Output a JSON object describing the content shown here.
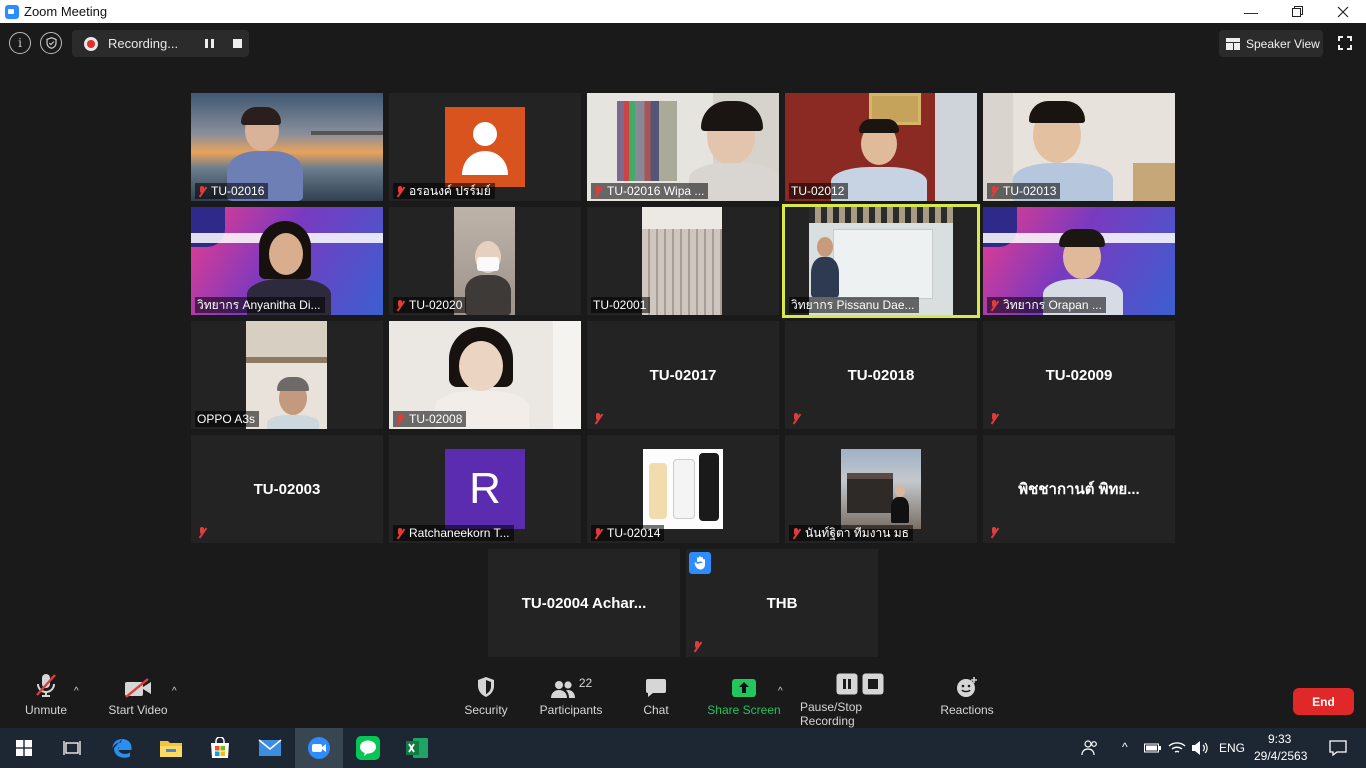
{
  "window": {
    "title": "Zoom Meeting"
  },
  "top_bar": {
    "recording_label": "Recording...",
    "speaker_view_label": "Speaker View"
  },
  "participants": [
    {
      "name": "TU-02016",
      "muted": true,
      "kind": "video"
    },
    {
      "name": "อรอนงค์ ปรร์มย์",
      "muted": true,
      "kind": "avatar"
    },
    {
      "name": "TU-02016 Wipa ...",
      "muted": true,
      "kind": "video"
    },
    {
      "name": "TU-02012",
      "muted": false,
      "kind": "video"
    },
    {
      "name": "TU-02013",
      "muted": true,
      "kind": "video"
    },
    {
      "name": "วิทยากร Anyanitha Di...",
      "muted": false,
      "kind": "video"
    },
    {
      "name": "TU-02020",
      "muted": true,
      "kind": "video"
    },
    {
      "name": "TU-02001",
      "muted": false,
      "kind": "video"
    },
    {
      "name": "วิทยากร Pissanu Dae...",
      "muted": false,
      "kind": "video",
      "active_speaker": true
    },
    {
      "name": "วิทยากร Orapan ...",
      "muted": true,
      "kind": "video"
    },
    {
      "name": "OPPO A3s",
      "muted": false,
      "kind": "video"
    },
    {
      "name": "TU-02008",
      "muted": true,
      "kind": "video"
    },
    {
      "name": "TU-02017",
      "muted": true,
      "kind": "name-only"
    },
    {
      "name": "TU-02018",
      "muted": true,
      "kind": "name-only"
    },
    {
      "name": "TU-02009",
      "muted": true,
      "kind": "name-only"
    },
    {
      "name": "TU-02003",
      "muted": true,
      "kind": "name-only"
    },
    {
      "name": "Ratchaneekorn T...",
      "muted": true,
      "kind": "avatar",
      "initial": "R"
    },
    {
      "name": "TU-02014",
      "muted": true,
      "kind": "video"
    },
    {
      "name": "นันท์ฐิตา ทีมงาน มธ",
      "muted": true,
      "kind": "video"
    },
    {
      "name": "พิชชากานต์ พิทย...",
      "muted": true,
      "kind": "name-only"
    },
    {
      "name": "TU-02004 Achar...",
      "muted": false,
      "kind": "name-only"
    },
    {
      "name": "THB",
      "muted": true,
      "kind": "name-only",
      "hand_raised": true
    }
  ],
  "toolbar": {
    "unmute": "Unmute",
    "start_video": "Start Video",
    "security": "Security",
    "participants": "Participants",
    "participants_count": "22",
    "chat": "Chat",
    "share_screen": "Share Screen",
    "recording": "Pause/Stop Recording",
    "reactions": "Reactions",
    "end": "End"
  },
  "taskbar": {
    "language": "ENG",
    "time": "9:33",
    "date": "29/4/2563"
  },
  "colors": {
    "accent_blue": "#2d8cff",
    "share_green": "#22c55e",
    "end_red": "#e02828",
    "active_speaker": "#d9e94a",
    "mute_red": "#e03c3c"
  }
}
